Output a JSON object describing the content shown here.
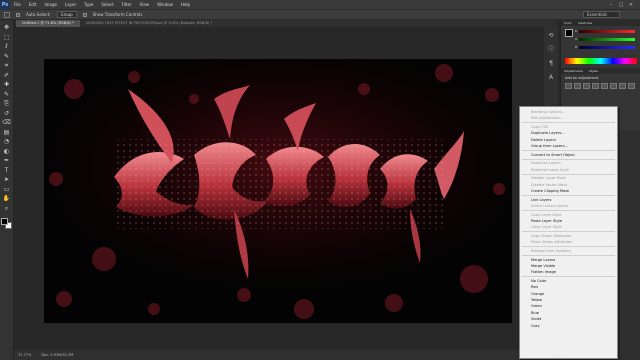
{
  "app": {
    "logo": "Ps"
  },
  "menubar": {
    "items": [
      "File",
      "Edit",
      "Image",
      "Layer",
      "Type",
      "Select",
      "Filter",
      "View",
      "Window",
      "Help"
    ]
  },
  "options_bar": {
    "auto_select_label": "Auto-Select:",
    "auto_select_value": "Group",
    "show_transform_label": "Show Transform Controls",
    "workspace": "Essentials"
  },
  "document_tabs": [
    {
      "label": "Untitled-1 @ 71.8% (RGB/8) *",
      "active": true
    },
    {
      "label": "CREATING TEXT EFFECT IN PHOTOSHOP.psd @ 100% (Bubbles, RGB/8) *",
      "active": false
    }
  ],
  "tools": [
    "move-tool",
    "marquee-tool",
    "lasso-tool",
    "quick-select-tool",
    "crop-tool",
    "eyedropper-tool",
    "healing-tool",
    "brush-tool",
    "clone-stamp-tool",
    "history-brush-tool",
    "eraser-tool",
    "gradient-tool",
    "blur-tool",
    "dodge-tool",
    "pen-tool",
    "type-tool",
    "path-select-tool",
    "shape-tool",
    "hand-tool",
    "zoom-tool"
  ],
  "tool_glyphs": [
    "✥",
    "⬚",
    "ℓ",
    "✎",
    "⌗",
    "✐",
    "✚",
    "✎",
    "⎘",
    "↺",
    "⌫",
    "▤",
    "◔",
    "◐",
    "✒",
    "T",
    "➤",
    "▭",
    "✋",
    "⌕"
  ],
  "colors": {
    "foreground": "#000000",
    "background": "#ffffff",
    "accent": "#c23a48"
  },
  "right_panel": {
    "tabs": [
      "Color",
      "Swatches"
    ],
    "channels": [
      "R",
      "G",
      "B"
    ],
    "adjust_tabs": [
      "Adjustments",
      "Styles"
    ],
    "adjust_title": "Add an adjustment"
  },
  "canvas": {
    "artwork": "glowing stylized red tribal text effect on black background with bokeh"
  },
  "statusbar": {
    "zoom": "71.77%",
    "doc": "Doc: 5.93M/32.3M"
  },
  "context_menu": {
    "items": [
      {
        "label": "Blending Options...",
        "enabled": false
      },
      {
        "label": "Edit Adjustment...",
        "enabled": false
      },
      {
        "sep": true
      },
      {
        "label": "Copy CSS",
        "enabled": false
      },
      {
        "label": "Duplicate Layers...",
        "enabled": true
      },
      {
        "label": "Delete Layers",
        "enabled": true
      },
      {
        "label": "Group from Layers...",
        "enabled": true
      },
      {
        "sep": true
      },
      {
        "label": "Convert to Smart Object",
        "enabled": true
      },
      {
        "sep": true
      },
      {
        "label": "Rasterize Layers",
        "enabled": false
      },
      {
        "label": "Rasterize Layer Style",
        "enabled": false
      },
      {
        "sep": true
      },
      {
        "label": "Disable Layer Mask",
        "enabled": false
      },
      {
        "label": "Disable Vector Mask",
        "enabled": false
      },
      {
        "label": "Create Clipping Mask",
        "enabled": true
      },
      {
        "sep": true
      },
      {
        "label": "Link Layers",
        "enabled": true
      },
      {
        "label": "Select Linked Layers",
        "enabled": false
      },
      {
        "sep": true
      },
      {
        "label": "Copy Layer Style",
        "enabled": false
      },
      {
        "label": "Paste Layer Style",
        "enabled": true
      },
      {
        "label": "Clear Layer Style",
        "enabled": false
      },
      {
        "sep": true
      },
      {
        "label": "Copy Shape Attributes",
        "enabled": false
      },
      {
        "label": "Paste Shape Attributes",
        "enabled": false
      },
      {
        "sep": true
      },
      {
        "label": "Release from Isolation",
        "enabled": false
      },
      {
        "sep": true
      },
      {
        "label": "Merge Layers",
        "enabled": true
      },
      {
        "label": "Merge Visible",
        "enabled": true
      },
      {
        "label": "Flatten Image",
        "enabled": true
      },
      {
        "sep": true
      },
      {
        "label": "No Color",
        "enabled": true
      },
      {
        "label": "Red",
        "enabled": true
      },
      {
        "label": "Orange",
        "enabled": true
      },
      {
        "label": "Yellow",
        "enabled": true
      },
      {
        "label": "Green",
        "enabled": true
      },
      {
        "label": "Blue",
        "enabled": true
      },
      {
        "label": "Violet",
        "enabled": true
      },
      {
        "label": "Gray",
        "enabled": true
      }
    ]
  }
}
